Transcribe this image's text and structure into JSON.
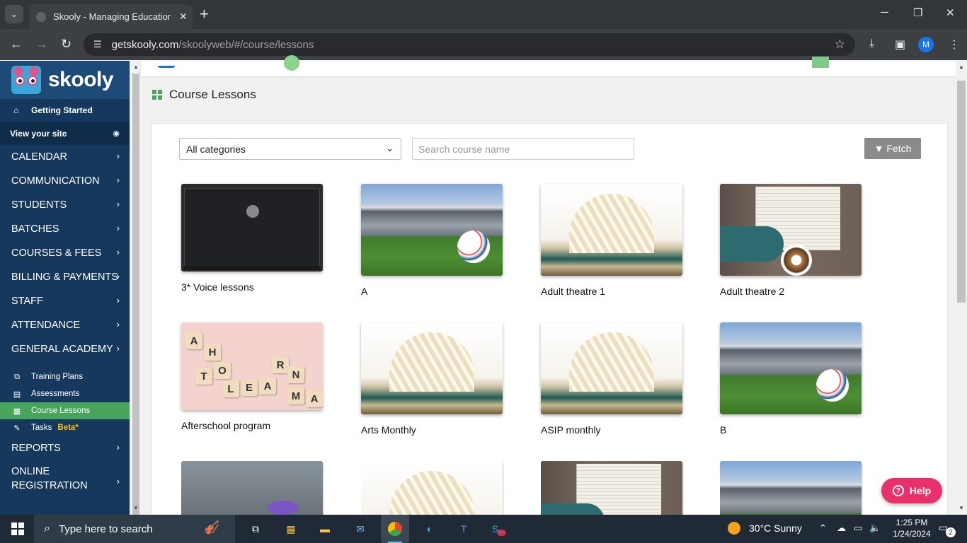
{
  "browser": {
    "tab_title": "Skooly - Managing Educational",
    "tab_close": "✕",
    "new_tab": "+",
    "url_host": "getskooly.com",
    "url_path": "/skoolyweb/#/course/lessons",
    "profile_initial": "M",
    "icons": [
      "back-icon",
      "forward-icon",
      "reload-icon",
      "site-settings-icon",
      "star-icon",
      "download-icon",
      "side-panel-icon",
      "menu-icon"
    ]
  },
  "sidebar": {
    "logo_text": "skooly",
    "getting_started": "Getting Started",
    "view_site": "View your site",
    "sections": [
      {
        "label": "CALENDAR"
      },
      {
        "label": "COMMUNICATION"
      },
      {
        "label": "STUDENTS"
      },
      {
        "label": "BATCHES"
      },
      {
        "label": "COURSES & FEES"
      },
      {
        "label": "BILLING & PAYMENTS"
      },
      {
        "label": "STAFF"
      },
      {
        "label": "ATTENDANCE"
      },
      {
        "label": "GENERAL ACADEMY"
      }
    ],
    "sub_items": [
      {
        "label": "Training Plans"
      },
      {
        "label": "Assessments"
      },
      {
        "label": "Course Lessons",
        "active": true
      },
      {
        "label": "Tasks",
        "badge": "Beta*"
      }
    ],
    "reports": "REPORTS",
    "online_reg_1": "ONLINE",
    "online_reg_2": "REGISTRATION"
  },
  "main": {
    "page_title": "Course Lessons",
    "category_select": "All categories",
    "search_placeholder": "Search course name",
    "fetch_label": "Fetch",
    "lessons": [
      {
        "name": "3* Voice lessons",
        "image": "browser-screenshot"
      },
      {
        "name": "A",
        "image": "stadium-football"
      },
      {
        "name": "Adult theatre 1",
        "image": "open-book"
      },
      {
        "name": "Adult theatre 2",
        "image": "book-and-coffee"
      },
      {
        "name": "Afterschool program",
        "image": "scrabble-learn"
      },
      {
        "name": "Arts Monthly",
        "image": "open-book"
      },
      {
        "name": "ASIP monthly",
        "image": "open-book"
      },
      {
        "name": "B",
        "image": "stadium-football"
      },
      {
        "name": "",
        "image": "lavender-books"
      },
      {
        "name": "",
        "image": "open-book"
      },
      {
        "name": "",
        "image": "book-and-coffee"
      },
      {
        "name": "",
        "image": "stadium-football"
      }
    ],
    "help_label": "Help"
  },
  "taskbar": {
    "search_placeholder": "Type here to search",
    "weather": "30°C  Sunny",
    "time": "1:25 PM",
    "date": "1/24/2024",
    "notifications": "2",
    "skype_badge": "9+"
  }
}
